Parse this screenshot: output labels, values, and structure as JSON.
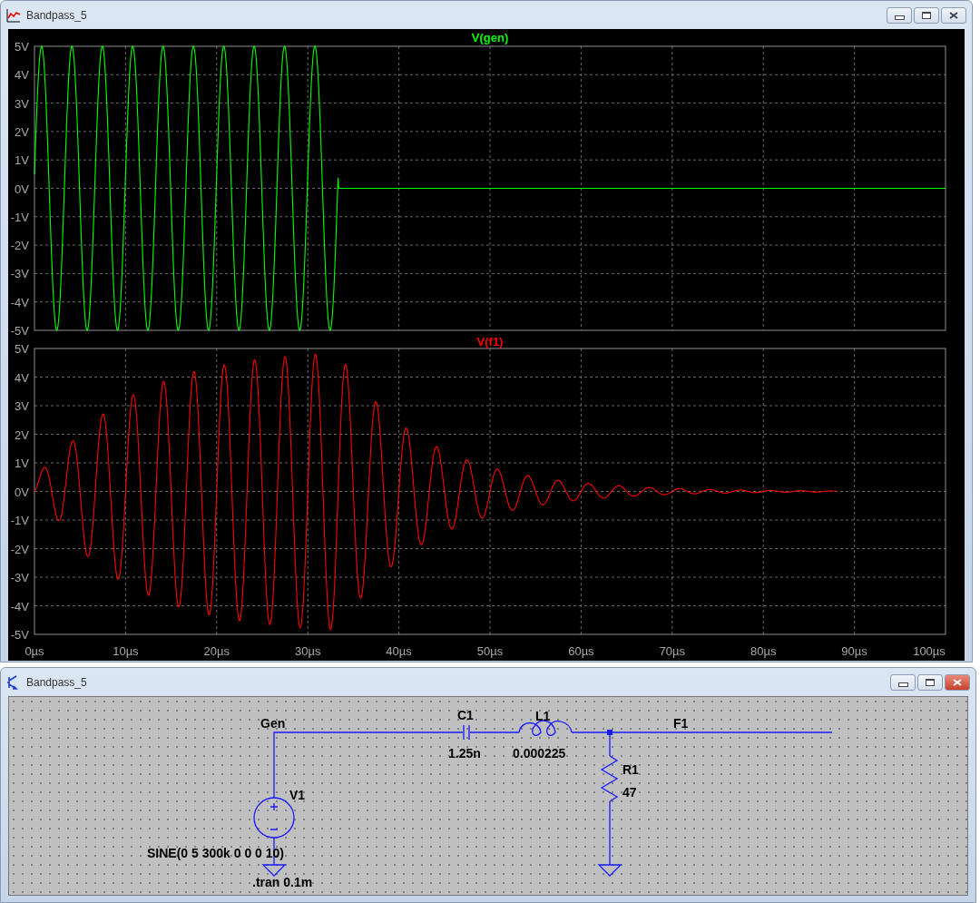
{
  "waveform_window": {
    "title": "Bandpass_5",
    "plots": [
      {
        "trace": "V(gen)",
        "color": "#00ff00",
        "yticks": [
          "5V",
          "4V",
          "3V",
          "2V",
          "1V",
          "0V",
          "-1V",
          "-2V",
          "-3V",
          "-4V",
          "-5V"
        ]
      },
      {
        "trace": "V(f1)",
        "color": "#ff0000",
        "yticks": [
          "5V",
          "4V",
          "3V",
          "2V",
          "1V",
          "0V",
          "-1V",
          "-2V",
          "-3V",
          "-4V",
          "-5V"
        ]
      }
    ],
    "xticks": [
      "0µs",
      "10µs",
      "20µs",
      "30µs",
      "40µs",
      "50µs",
      "60µs",
      "70µs",
      "80µs",
      "90µs",
      "100µs"
    ]
  },
  "schematic_window": {
    "title": "Bandpass_5",
    "nets": [
      {
        "label": "Gen"
      },
      {
        "label": "F1"
      }
    ],
    "components": [
      {
        "kind": "capacitor",
        "name": "C1",
        "value": "1.25n"
      },
      {
        "kind": "inductor",
        "name": "L1",
        "value": "0.000225"
      },
      {
        "kind": "resistor",
        "name": "R1",
        "value": "47"
      },
      {
        "kind": "source",
        "name": "V1",
        "value": "SINE(0 5 300k 0 0 0 10)"
      }
    ],
    "directive": ".tran 0.1m"
  }
}
